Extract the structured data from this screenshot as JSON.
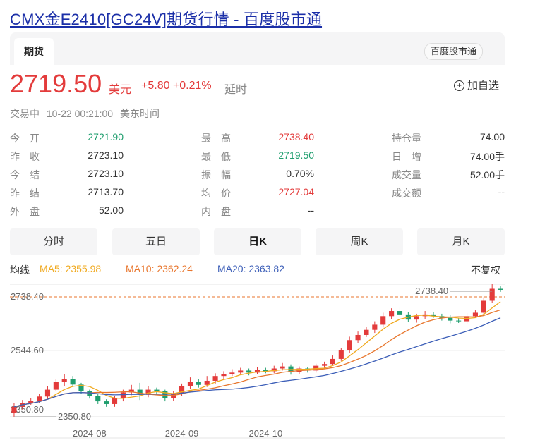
{
  "page": {
    "title": "CMX金E2410[GC24V]期货行情 - 百度股市通",
    "tab": "期货",
    "source": "百度股市通"
  },
  "quote": {
    "price": "2719.50",
    "currency": "美元",
    "change": "+5.80",
    "change_pct": "+0.21%",
    "delay": "延时",
    "watch": "加自选",
    "status": "交易中",
    "time": "10-22 00:21:00",
    "timezone": "美东时间"
  },
  "stats": {
    "col1": [
      {
        "label": "今　开",
        "value": "2721.90",
        "color": "#1f9e6e"
      },
      {
        "label": "昨　收",
        "value": "2723.10",
        "color": "#333333"
      },
      {
        "label": "今　结",
        "value": "2723.10",
        "color": "#333333"
      },
      {
        "label": "昨　结",
        "value": "2713.70",
        "color": "#333333"
      },
      {
        "label": "外　盘",
        "value": "52.00",
        "color": "#333333"
      }
    ],
    "col2": [
      {
        "label": "最　高",
        "value": "2738.40",
        "color": "#e33b3b"
      },
      {
        "label": "最　低",
        "value": "2719.50",
        "color": "#1f9e6e"
      },
      {
        "label": "振　幅",
        "value": "0.70%",
        "color": "#333333"
      },
      {
        "label": "均　价",
        "value": "2727.04",
        "color": "#e33b3b"
      },
      {
        "label": "内　盘",
        "value": "--",
        "color": "#333333"
      }
    ],
    "col3": [
      {
        "label": "持仓量",
        "value": "74.00",
        "color": "#333333"
      },
      {
        "label": "日　增",
        "value": "74.00手",
        "color": "#333333"
      },
      {
        "label": "成交量",
        "value": "52.00手",
        "color": "#333333"
      },
      {
        "label": "成交额",
        "value": "--",
        "color": "#333333"
      }
    ]
  },
  "period_tabs": [
    "分时",
    "五日",
    "日K",
    "周K",
    "月K"
  ],
  "active_tab": "日K",
  "indicators": {
    "label": "均线",
    "ma5": "MA5: 2355.98",
    "ma10": "MA10: 2362.24",
    "ma20": "MA20: 2363.82",
    "adjust": "不复权",
    "colors": {
      "ma5": "#f0a91e",
      "ma10": "#e8762d",
      "ma20": "#3d5fb8",
      "up": "#e33b3b",
      "down": "#1f9e6e"
    }
  },
  "chart_data": {
    "type": "candlestick",
    "y_ticks": [
      "2738.40",
      "2544.60",
      "2350.80"
    ],
    "ylim": [
      2350.8,
      2738.4
    ],
    "x_ticks": [
      {
        "label": "2024-08",
        "index": 9
      },
      {
        "label": "2024-09",
        "index": 20
      },
      {
        "label": "2024-10",
        "index": 30
      }
    ],
    "max_label": "2738.40",
    "min_label": "2350.80",
    "series": [
      {
        "name": "K",
        "values": [
          [
            2362,
            2380,
            2350.8,
            2392
          ],
          [
            2380,
            2392,
            2372,
            2400
          ],
          [
            2392,
            2398,
            2386,
            2406
          ],
          [
            2398,
            2410,
            2390,
            2418
          ],
          [
            2410,
            2430,
            2402,
            2440
          ],
          [
            2430,
            2452,
            2426,
            2462
          ],
          [
            2452,
            2462,
            2440,
            2476
          ],
          [
            2462,
            2445,
            2438,
            2470
          ],
          [
            2445,
            2425,
            2418,
            2450
          ],
          [
            2425,
            2412,
            2404,
            2430
          ],
          [
            2412,
            2396,
            2388,
            2418
          ],
          [
            2396,
            2388,
            2380,
            2402
          ],
          [
            2388,
            2405,
            2380,
            2412
          ],
          [
            2405,
            2422,
            2396,
            2430
          ],
          [
            2422,
            2430,
            2414,
            2444
          ],
          [
            2430,
            2415,
            2400,
            2450
          ],
          [
            2415,
            2430,
            2408,
            2440
          ],
          [
            2430,
            2425,
            2416,
            2436
          ],
          [
            2425,
            2405,
            2396,
            2430
          ],
          [
            2405,
            2418,
            2398,
            2426
          ],
          [
            2418,
            2440,
            2412,
            2448
          ],
          [
            2440,
            2452,
            2432,
            2466
          ],
          [
            2452,
            2444,
            2436,
            2460
          ],
          [
            2444,
            2456,
            2438,
            2470
          ],
          [
            2456,
            2470,
            2448,
            2478
          ],
          [
            2470,
            2476,
            2462,
            2484
          ],
          [
            2476,
            2480,
            2470,
            2490
          ],
          [
            2480,
            2486,
            2474,
            2494
          ],
          [
            2486,
            2480,
            2472,
            2492
          ],
          [
            2480,
            2488,
            2475,
            2496
          ],
          [
            2488,
            2484,
            2478,
            2494
          ],
          [
            2484,
            2492,
            2478,
            2500
          ],
          [
            2492,
            2498,
            2486,
            2508
          ],
          [
            2498,
            2482,
            2474,
            2504
          ],
          [
            2482,
            2492,
            2476,
            2498
          ],
          [
            2492,
            2486,
            2480,
            2496
          ],
          [
            2486,
            2500,
            2480,
            2506
          ],
          [
            2500,
            2505,
            2494,
            2512
          ],
          [
            2505,
            2520,
            2500,
            2530
          ],
          [
            2520,
            2545,
            2514,
            2552
          ],
          [
            2545,
            2575,
            2538,
            2585
          ],
          [
            2575,
            2590,
            2566,
            2600
          ],
          [
            2590,
            2605,
            2584,
            2614
          ],
          [
            2605,
            2620,
            2596,
            2630
          ],
          [
            2620,
            2645,
            2612,
            2655
          ],
          [
            2645,
            2660,
            2636,
            2668
          ],
          [
            2660,
            2650,
            2640,
            2670
          ],
          [
            2650,
            2635,
            2628,
            2658
          ],
          [
            2635,
            2645,
            2626,
            2652
          ],
          [
            2645,
            2650,
            2636,
            2660
          ],
          [
            2650,
            2645,
            2640,
            2656
          ],
          [
            2645,
            2640,
            2632,
            2652
          ],
          [
            2640,
            2632,
            2624,
            2648
          ],
          [
            2632,
            2630,
            2625,
            2640
          ],
          [
            2630,
            2645,
            2622,
            2654
          ],
          [
            2645,
            2655,
            2640,
            2662
          ],
          [
            2655,
            2690,
            2648,
            2700
          ],
          [
            2690,
            2725,
            2684,
            2738.4
          ],
          [
            2725,
            2722,
            2716,
            2732
          ]
        ]
      }
    ]
  }
}
